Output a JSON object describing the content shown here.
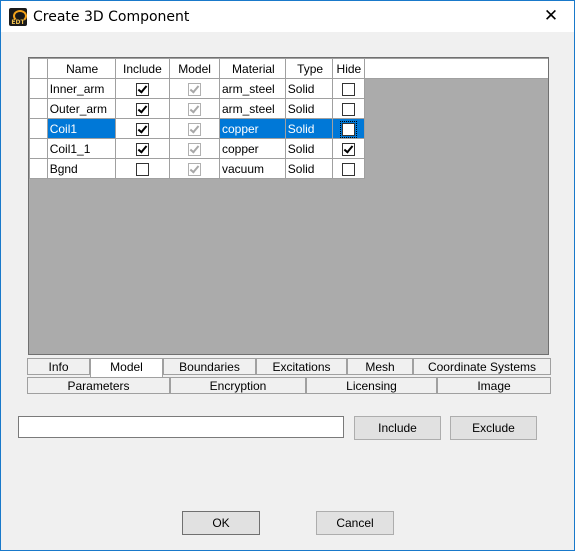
{
  "window": {
    "title": "Create 3D Component",
    "close_glyph": "✕",
    "icon_text": "EDT"
  },
  "grid": {
    "columns": [
      "Name",
      "Include",
      "Model",
      "Material",
      "Type",
      "Hide"
    ],
    "rows": [
      {
        "name": "Inner_arm",
        "include": true,
        "model": true,
        "material": "arm_steel",
        "type": "Solid",
        "hide": false,
        "selected": false
      },
      {
        "name": "Outer_arm",
        "include": true,
        "model": true,
        "material": "arm_steel",
        "type": "Solid",
        "hide": false,
        "selected": false
      },
      {
        "name": "Coil1",
        "include": true,
        "model": true,
        "material": "copper",
        "type": "Solid",
        "hide": false,
        "selected": true
      },
      {
        "name": "Coil1_1",
        "include": true,
        "model": true,
        "material": "copper",
        "type": "Solid",
        "hide": true,
        "selected": false
      },
      {
        "name": "Bgnd",
        "include": false,
        "model": true,
        "material": "vacuum",
        "type": "Solid",
        "hide": false,
        "selected": false
      }
    ]
  },
  "tabs": {
    "row1": [
      "Info",
      "Model",
      "Boundaries",
      "Excitations",
      "Mesh",
      "Coordinate Systems"
    ],
    "row2": [
      "Parameters",
      "Encryption",
      "Licensing",
      "Image"
    ],
    "active": "Model"
  },
  "filter": {
    "value": "",
    "include_label": "Include",
    "exclude_label": "Exclude"
  },
  "footer": {
    "ok_label": "OK",
    "cancel_label": "Cancel"
  },
  "colors": {
    "selection": "#0078d7",
    "border_accent": "#1979ca"
  }
}
